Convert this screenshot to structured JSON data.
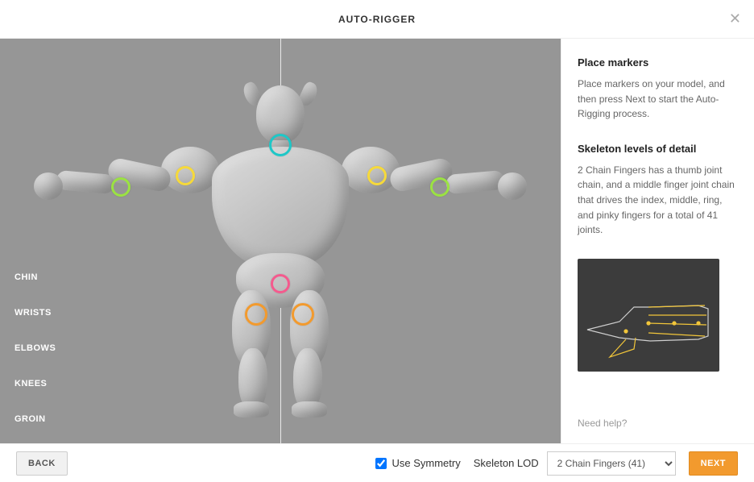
{
  "header": {
    "title": "AUTO-RIGGER"
  },
  "markerLabels": {
    "chin": "CHIN",
    "wrists": "WRISTS",
    "elbows": "ELBOWS",
    "knees": "KNEES",
    "groin": "GROIN"
  },
  "sidePanel": {
    "placeMarkers": {
      "heading": "Place markers",
      "text": "Place markers on your model, and then press Next to start the Auto-Rigging process."
    },
    "skeletonLod": {
      "heading": "Skeleton levels of detail",
      "text": "2 Chain Fingers has a thumb joint chain, and a middle finger joint chain that drives the index, middle, ring, and pinky fingers for a total of 41 joints."
    },
    "helpLink": "Need help?"
  },
  "footer": {
    "backLabel": "BACK",
    "nextLabel": "NEXT",
    "symmetryLabel": "Use Symmetry",
    "symmetryChecked": true,
    "lodLabel": "Skeleton LOD",
    "lodSelected": "2 Chain Fingers (41)"
  }
}
